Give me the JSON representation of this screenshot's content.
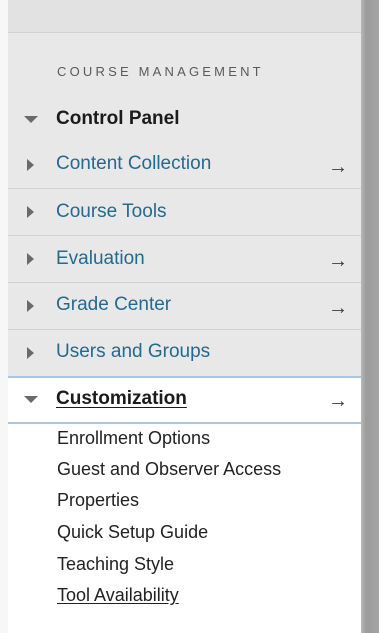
{
  "section_title": "COURSE MANAGEMENT",
  "control_panel": {
    "label": "Control Panel"
  },
  "nav_items": [
    {
      "label": "Content Collection",
      "arrow": "→"
    },
    {
      "label": "Course Tools",
      "arrow": ""
    },
    {
      "label": "Evaluation",
      "arrow": "→"
    },
    {
      "label": "Grade Center",
      "arrow": "→"
    },
    {
      "label": "Users and Groups",
      "arrow": ""
    }
  ],
  "customization": {
    "label": "Customization",
    "arrow": "→",
    "items": [
      {
        "label": "Enrollment Options"
      },
      {
        "label": "Guest and Observer Access"
      },
      {
        "label": "Properties"
      },
      {
        "label": "Quick Setup Guide"
      },
      {
        "label": "Teaching Style"
      },
      {
        "label": "Tool Availability"
      }
    ]
  },
  "colors": {
    "link": "#236a8f",
    "heading": "#1b1b1b",
    "panel_bg": "#e8e8e8",
    "selected_border": "#a9c7e2"
  }
}
